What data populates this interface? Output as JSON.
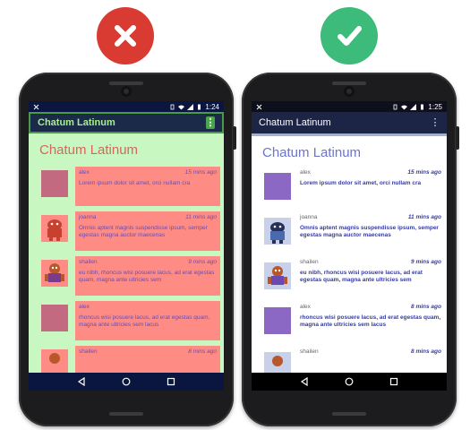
{
  "badges": {
    "bad_icon": "cross-icon",
    "good_icon": "check-icon",
    "bad_color": "#d93a32",
    "good_color": "#3dbb7a"
  },
  "bad_phone": {
    "status_time": "1:24",
    "app_title": "Chatum Latinum",
    "heading": "Chatum Latinum",
    "messages": [
      {
        "name": "alex",
        "time": "15 mins ago",
        "text": "Lorem ipsum dolor sit amet, orci nullam cra",
        "avatar": "plain"
      },
      {
        "name": "joanna",
        "time": "11 mins ago",
        "text": "Omnis aptent magnis suspendisse ipsum, semper egestas magna auctor maecenas",
        "avatar": "robot"
      },
      {
        "name": "shailen",
        "time": "9 mins ago",
        "text": "eu nibh, rhoncus wisi posuere lacus, ad erat egestas quam, magna ante ultricies sem",
        "avatar": "robot"
      },
      {
        "name": "alex",
        "time": "",
        "text": "rhoncus wisi posuere lacus, ad erat egestas quam, magna ante ultricies sem lacus",
        "avatar": "plain"
      },
      {
        "name": "shailen",
        "time": "8 mins ago",
        "text": "",
        "avatar": "robot"
      }
    ]
  },
  "good_phone": {
    "status_time": "1:25",
    "app_title": "Chatum Latinum",
    "heading": "Chatum Latinum",
    "messages": [
      {
        "name": "alex",
        "time": "15 mins ago",
        "text": "Lorem ipsum dolor sit amet, orci nullam cra",
        "avatar": "plain"
      },
      {
        "name": "joanna",
        "time": "11 mins ago",
        "text": "Omnis aptent magnis suspendisse ipsum, semper egestas magna auctor maecenas",
        "avatar": "robot"
      },
      {
        "name": "shailen",
        "time": "9 mins ago",
        "text": "eu nibh, rhoncus wisi posuere lacus, ad erat egestas quam, magna ante ultricies sem",
        "avatar": "robot"
      },
      {
        "name": "alex",
        "time": "8 mins ago",
        "text": "rhoncus wisi posuere lacus, ad erat egestas quam, magna ante ultricies sem lacus",
        "avatar": "plain"
      },
      {
        "name": "shailen",
        "time": "8 mins ago",
        "text": "",
        "avatar": "robot"
      }
    ]
  }
}
